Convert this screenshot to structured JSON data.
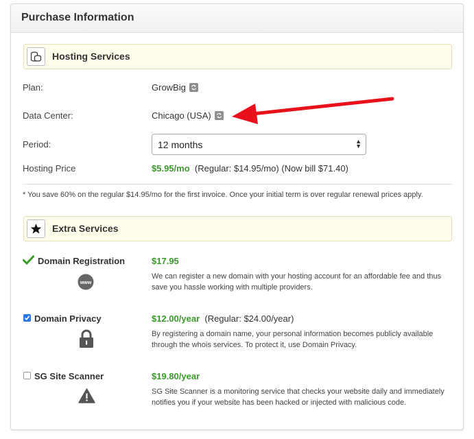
{
  "panel": {
    "title": "Purchase Information"
  },
  "hosting": {
    "section_title": "Hosting Services",
    "icon": "coins-stack-icon",
    "plan_label": "Plan:",
    "plan_value": "GrowBig",
    "datacenter_label": "Data Center:",
    "datacenter_value": "Chicago (USA)",
    "period_label": "Period:",
    "period_value": "12 months",
    "price_label": "Hosting Price",
    "price_value": "$5.95/mo",
    "price_regular": "(Regular: $14.95/mo) (Now bill $71.40)"
  },
  "footnote": "* You save 60% on the regular $14.95/mo for the first invoice. Once your initial term is over regular renewal prices apply.",
  "extra": {
    "section_title": "Extra Services",
    "icon": "star-icon",
    "services": [
      {
        "name": "Domain Registration",
        "selected": true,
        "indicator": "checkmark-icon",
        "icon": "www-globe-icon",
        "price": "$17.95",
        "regular": "",
        "description": "We can register a new domain with your hosting account for an affordable fee and thus save you hassle working with multiple providers."
      },
      {
        "name": "Domain Privacy",
        "selected": true,
        "indicator": "checkbox",
        "icon": "padlock-icon",
        "price": "$12.00/year",
        "regular": "(Regular: $24.00/year)",
        "description": "By registering a domain name, your personal information becomes publicly available through the whois services. To protect it, use Domain Privacy."
      },
      {
        "name": "SG Site Scanner",
        "selected": false,
        "indicator": "checkbox",
        "icon": "warning-triangle-icon",
        "price": "$19.80/year",
        "regular": "",
        "description": "SG Site Scanner is a monitoring service that checks your website daily and immediately notifies you if your website has been hacked or injected with malicious code."
      }
    ]
  },
  "colors": {
    "accent_green": "#3a9a2a",
    "annotation_red": "#e8101a",
    "section_bg": "#fffdeb"
  }
}
